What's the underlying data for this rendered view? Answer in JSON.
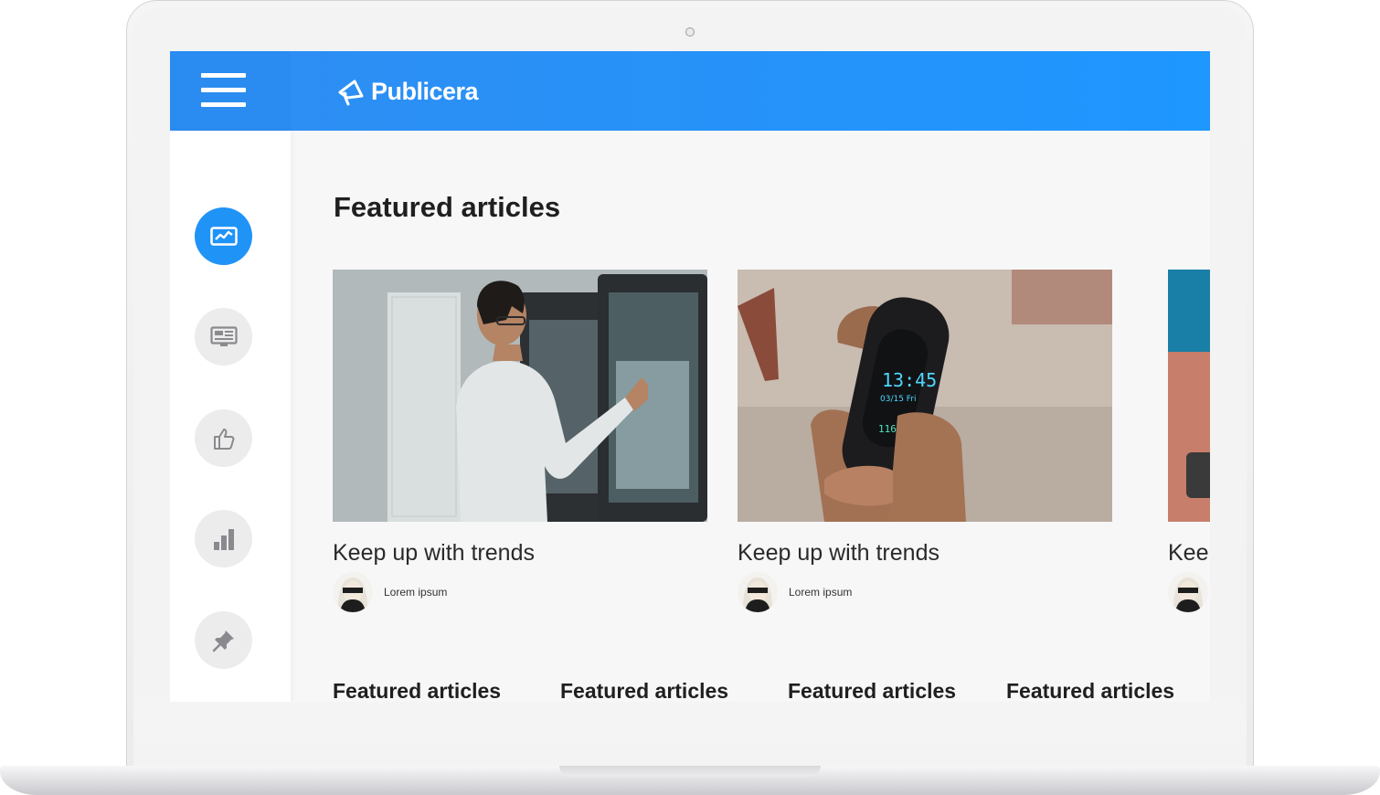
{
  "app": {
    "name": "Publicera"
  },
  "colors": {
    "brand": "#1e97ff",
    "active_nav": "#2093f7",
    "nav_bg": "#ececed"
  },
  "header": {
    "menu_icon": "hamburger-menu-icon",
    "logo_icon": "megaphone-icon"
  },
  "sidebar": {
    "items": [
      {
        "icon": "dashboard-chart-icon",
        "active": true
      },
      {
        "icon": "news-feed-icon",
        "active": false
      },
      {
        "icon": "thumbs-up-icon",
        "active": false
      },
      {
        "icon": "bar-chart-icon",
        "active": false
      },
      {
        "icon": "pin-icon",
        "active": false
      }
    ]
  },
  "main": {
    "section_title": "Featured articles",
    "cards": [
      {
        "title": "Keep up with trends",
        "author": "Lorem ipsum"
      },
      {
        "title": "Keep up with trends",
        "author": "Lorem ipsum"
      },
      {
        "title": "Kee"
      }
    ],
    "watch": {
      "time": "13:45",
      "date": "03/15 Fri",
      "steps": "1162"
    },
    "bottom_tabs": [
      {
        "label": "Featured articles"
      },
      {
        "label": "Featured articles"
      },
      {
        "label": "Featured articles"
      },
      {
        "label": "Featured articles"
      }
    ]
  }
}
